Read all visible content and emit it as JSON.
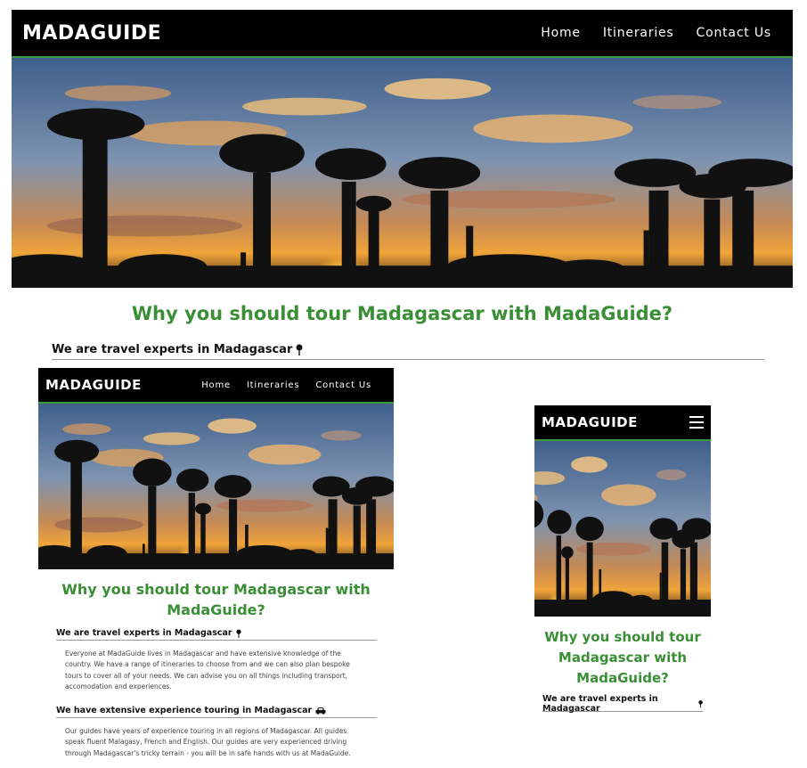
{
  "brand": {
    "logo": "MADAGUIDE",
    "accent": "#3a8f36",
    "nav_bg": "#000000"
  },
  "nav": {
    "home": "Home",
    "itineraries": "Itineraries",
    "contact": "Contact Us"
  },
  "main": {
    "title": "Why you should tour Madagascar with MadaGuide?",
    "sections": [
      {
        "heading": "We are travel experts in Madagascar",
        "icon": "map-pin-icon",
        "text": "Everyone at MadaGuide lives in Madagascar and have extensive knowledge of the country. We have a range of itineraries to choose from and we can also plan bespoke tours to cover all of your needs. We can advise you on all things including transport, accomodation and experiences."
      },
      {
        "heading": "We have extensive experience touring in Madagascar",
        "icon": "car-icon",
        "text": "Our guides have years of experience touring in all regions of Madagascar. All guides speak fluent Malagasy, French and English. Our guides are very experienced driving through Madagascar's tricky terrain - you will be in safe hands with us at MadaGuide."
      }
    ]
  },
  "tablet": {
    "title_line1": "Why you should tour Madagascar with",
    "title_line2": "MadaGuide?"
  },
  "mobile": {
    "title_line1": "Why you should tour",
    "title_line2": "Madagascar with",
    "title_line3": "MadaGuide?",
    "menu_icon": "hamburger-menu-icon"
  }
}
